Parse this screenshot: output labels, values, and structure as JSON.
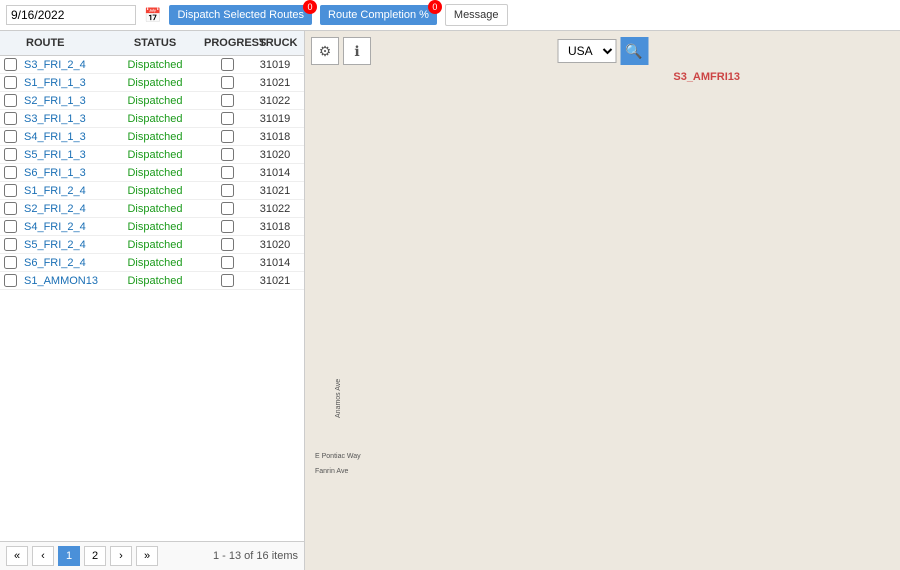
{
  "topbar": {
    "date": "9/16/2022",
    "calendar_icon": "📅",
    "btn_dispatch": "Dispatch Selected Routes",
    "btn_route": "Route Completion %",
    "btn_message": "Message",
    "badge_dispatch": "0",
    "badge_route": "0"
  },
  "table": {
    "headers": [
      "",
      "ROUTE",
      "STATUS",
      "PROGRESS",
      "TRUCK"
    ],
    "rows": [
      {
        "route": "S3_FRI_2_4",
        "status": "Dispatched",
        "truck": "31019"
      },
      {
        "route": "S1_FRI_1_3",
        "status": "Dispatched",
        "truck": "31021"
      },
      {
        "route": "S2_FRI_1_3",
        "status": "Dispatched",
        "truck": "31022"
      },
      {
        "route": "S3_FRI_1_3",
        "status": "Dispatched",
        "truck": "31019"
      },
      {
        "route": "S4_FRI_1_3",
        "status": "Dispatched",
        "truck": "31018"
      },
      {
        "route": "S5_FRI_1_3",
        "status": "Dispatched",
        "truck": "31020"
      },
      {
        "route": "S6_FRI_1_3",
        "status": "Dispatched",
        "truck": "31014"
      },
      {
        "route": "S1_FRI_2_4",
        "status": "Dispatched",
        "truck": "31021"
      },
      {
        "route": "S2_FRI_2_4",
        "status": "Dispatched",
        "truck": "31022"
      },
      {
        "route": "S4_FRI_2_4",
        "status": "Dispatched",
        "truck": "31018"
      },
      {
        "route": "S5_FRI_2_4",
        "status": "Dispatched",
        "truck": "31020"
      },
      {
        "route": "S6_FRI_2_4",
        "status": "Dispatched",
        "truck": "31014"
      },
      {
        "route": "S1_AMMON13",
        "status": "Dispatched",
        "truck": "31021"
      }
    ],
    "pagination": {
      "current_page": 1,
      "total_pages": 2,
      "items_info": "1 - 13 of 16 items"
    }
  },
  "map": {
    "country": "USA",
    "label": "S3_AMFRI13",
    "gear_icon": "⚙",
    "info_icon": "ℹ",
    "search_icon": "🔍"
  }
}
